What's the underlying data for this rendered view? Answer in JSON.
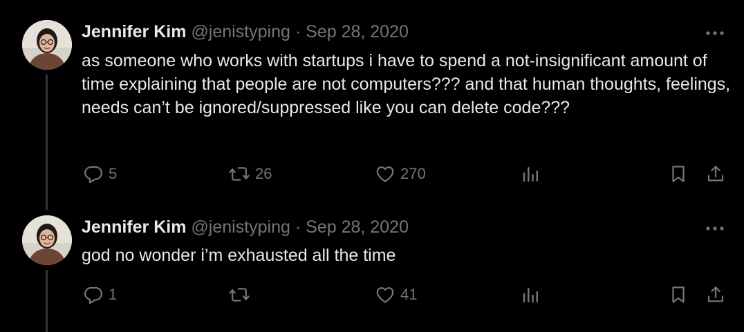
{
  "tweets": [
    {
      "author": {
        "name": "Jennifer Kim",
        "handle": "@jenistyping",
        "avatar_icon": "profile-photo"
      },
      "separator": "·",
      "date": "Sep 28, 2020",
      "text": "as someone who works with startups i have to spend a not-insignificant amount of time explaining that people are not computers??? and that human thoughts, feelings, needs can’t be ignored/suppressed like you can delete code???",
      "actions": {
        "replies": "5",
        "retweets": "26",
        "likes": "270"
      }
    },
    {
      "author": {
        "name": "Jennifer Kim",
        "handle": "@jenistyping",
        "avatar_icon": "profile-photo"
      },
      "separator": "·",
      "date": "Sep 28, 2020",
      "text": "god no wonder i’m exhausted all the time",
      "actions": {
        "replies": "1",
        "retweets": "",
        "likes": "41"
      }
    }
  ],
  "colors": {
    "background": "#000000",
    "primary_text": "#e7e9ea",
    "secondary_text": "#71767b",
    "thread_line": "#333639"
  },
  "icons": [
    "reply-icon",
    "retweet-icon",
    "like-icon",
    "views-icon",
    "bookmark-icon",
    "share-icon",
    "more-icon"
  ]
}
